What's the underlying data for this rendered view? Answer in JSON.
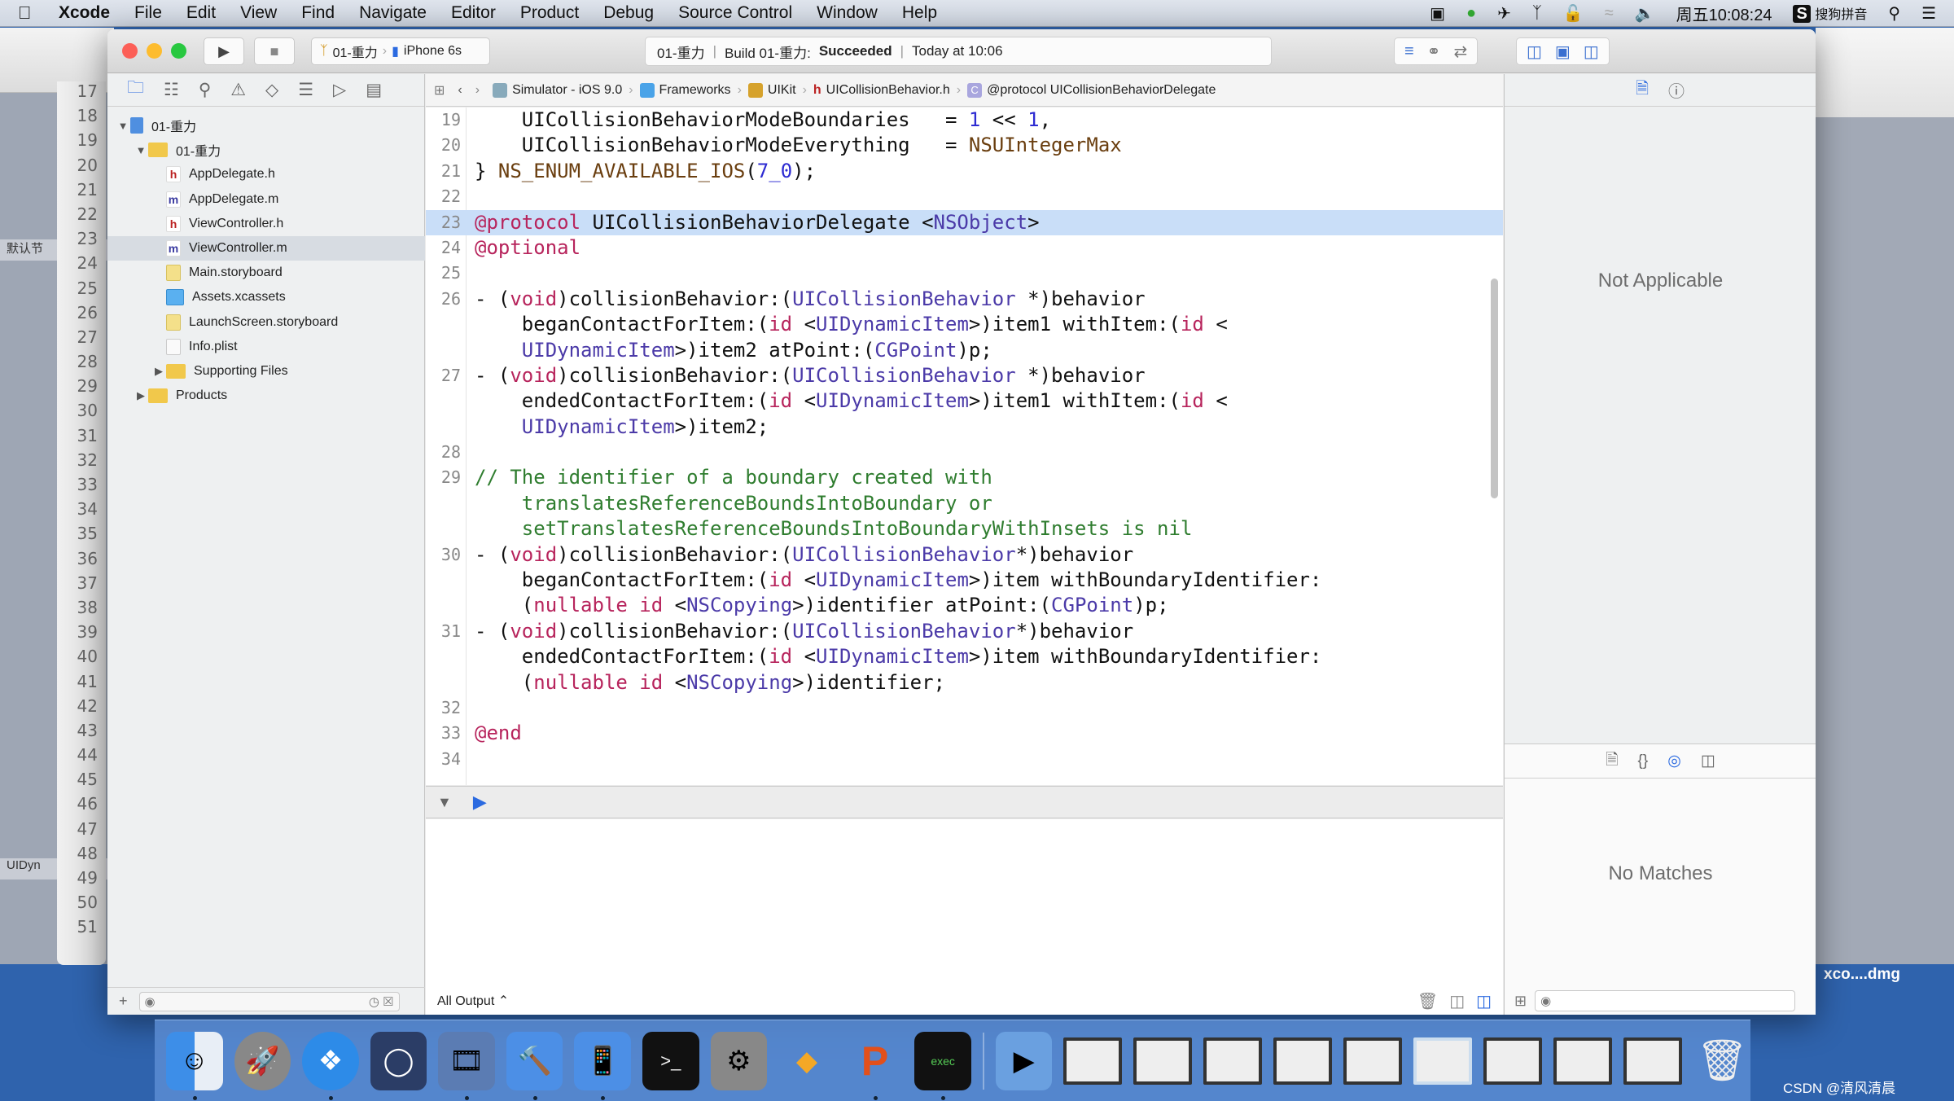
{
  "menubar": {
    "app": "Xcode",
    "items": [
      "File",
      "Edit",
      "View",
      "Find",
      "Navigate",
      "Editor",
      "Product",
      "Debug",
      "Source Control",
      "Window",
      "Help"
    ],
    "status": {
      "clock": "周五10:08:24",
      "input_method": "搜狗拼音",
      "icons": [
        "screen-record-icon",
        "app-status-icon",
        "airplane-icon",
        "bluetooth-icon",
        "lock-icon",
        "wifi-icon",
        "volume-icon",
        "input-method-icon",
        "spotlight-icon",
        "notification-center-icon"
      ]
    }
  },
  "toolbar": {
    "scheme": "01-重力",
    "device": "iPhone 6s",
    "activity": {
      "project": "01-重力",
      "build_prefix": "Build 01-重力:",
      "build_status": "Succeeded",
      "time": "Today at 10:06"
    }
  },
  "navigator": {
    "tabs": [
      "project-navigator",
      "symbol-navigator",
      "find-navigator",
      "issue-navigator",
      "test-navigator",
      "debug-navigator",
      "breakpoint-navigator",
      "report-navigator"
    ],
    "tree": [
      {
        "label": "01-重力",
        "type": "project",
        "level": 0,
        "expanded": true
      },
      {
        "label": "01-重力",
        "type": "folder",
        "level": 1,
        "expanded": true
      },
      {
        "label": "AppDelegate.h",
        "type": "h",
        "level": 2
      },
      {
        "label": "AppDelegate.m",
        "type": "m",
        "level": 2
      },
      {
        "label": "ViewController.h",
        "type": "h",
        "level": 2
      },
      {
        "label": "ViewController.m",
        "type": "m",
        "level": 2,
        "selected": true
      },
      {
        "label": "Main.storyboard",
        "type": "storyboard",
        "level": 2
      },
      {
        "label": "Assets.xcassets",
        "type": "xcassets",
        "level": 2
      },
      {
        "label": "LaunchScreen.storyboard",
        "type": "storyboard",
        "level": 2
      },
      {
        "label": "Info.plist",
        "type": "plist",
        "level": 2
      },
      {
        "label": "Supporting Files",
        "type": "folder",
        "level": 2,
        "expanded": false
      },
      {
        "label": "Products",
        "type": "folder",
        "level": 1,
        "expanded": false
      }
    ]
  },
  "jumpbar": {
    "crumbs": [
      "Simulator - iOS 9.0",
      "Frameworks",
      "UIKit",
      "UICollisionBehavior.h",
      "@protocol UICollisionBehaviorDelegate"
    ]
  },
  "editor": {
    "lines": [
      {
        "n": "19",
        "html": "    UICollisionBehaviorModeBoundaries   = <span class=\"num\">1</span> &lt;&lt; <span class=\"num\">1</span>,"
      },
      {
        "n": "20",
        "html": "    UICollisionBehaviorModeEverything   = <span class=\"mac\">NSUIntegerMax</span>"
      },
      {
        "n": "21",
        "html": "} <span class=\"mac\">NS_ENUM_AVAILABLE_IOS</span>(<span class=\"num\">7_0</span>);"
      },
      {
        "n": "22",
        "html": ""
      },
      {
        "n": "23",
        "html": "<span class=\"kw\">@protocol</span> UICollisionBehaviorDelegate &lt;<span class=\"ty\">NSObject</span>&gt;",
        "hl": true
      },
      {
        "n": "24",
        "html": "<span class=\"kw\">@optional</span>"
      },
      {
        "n": "25",
        "html": ""
      },
      {
        "n": "26",
        "html": "- (<span class=\"kw\">void</span>)collisionBehavior:(<span class=\"ty\">UICollisionBehavior</span> *)behavior"
      },
      {
        "n": "",
        "html": "    beganContactForItem:(<span class=\"kw\">id</span> &lt;<span class=\"ty\">UIDynamicItem</span>&gt;)item1 withItem:(<span class=\"kw\">id</span> &lt;"
      },
      {
        "n": "",
        "html": "    <span class=\"ty\">UIDynamicItem</span>&gt;)item2 atPoint:(<span class=\"ty\">CGPoint</span>)p;"
      },
      {
        "n": "27",
        "html": "- (<span class=\"kw\">void</span>)collisionBehavior:(<span class=\"ty\">UICollisionBehavior</span> *)behavior"
      },
      {
        "n": "",
        "html": "    endedContactForItem:(<span class=\"kw\">id</span> &lt;<span class=\"ty\">UIDynamicItem</span>&gt;)item1 withItem:(<span class=\"kw\">id</span> &lt;"
      },
      {
        "n": "",
        "html": "    <span class=\"ty\">UIDynamicItem</span>&gt;)item2;"
      },
      {
        "n": "28",
        "html": ""
      },
      {
        "n": "29",
        "html": "<span class=\"cm\">// The identifier of a boundary created with</span>"
      },
      {
        "n": "",
        "html": "<span class=\"cm\">    translatesReferenceBoundsIntoBoundary or</span>"
      },
      {
        "n": "",
        "html": "<span class=\"cm\">    setTranslatesReferenceBoundsIntoBoundaryWithInsets is nil</span>"
      },
      {
        "n": "30",
        "html": "- (<span class=\"kw\">void</span>)collisionBehavior:(<span class=\"ty\">UICollisionBehavior</span>*)behavior"
      },
      {
        "n": "",
        "html": "    beganContactForItem:(<span class=\"kw\">id</span> &lt;<span class=\"ty\">UIDynamicItem</span>&gt;)item withBoundaryIdentifier:"
      },
      {
        "n": "",
        "html": "    (<span class=\"kw\">nullable</span> <span class=\"kw\">id</span> &lt;<span class=\"ty\">NSCopying</span>&gt;)identifier atPoint:(<span class=\"ty\">CGPoint</span>)p;"
      },
      {
        "n": "31",
        "html": "- (<span class=\"kw\">void</span>)collisionBehavior:(<span class=\"ty\">UICollisionBehavior</span>*)behavior"
      },
      {
        "n": "",
        "html": "    endedContactForItem:(<span class=\"kw\">id</span> &lt;<span class=\"ty\">UIDynamicItem</span>&gt;)item withBoundaryIdentifier:"
      },
      {
        "n": "",
        "html": "    (<span class=\"kw\">nullable</span> <span class=\"kw\">id</span> &lt;<span class=\"ty\">NSCopying</span>&gt;)identifier;"
      },
      {
        "n": "32",
        "html": ""
      },
      {
        "n": "33",
        "html": "<span class=\"kw\">@end</span>"
      },
      {
        "n": "34",
        "html": ""
      }
    ]
  },
  "console": {
    "filter": "All Output ⌃"
  },
  "inspector": {
    "empty_text": "Not Applicable",
    "library_empty_text": "No Matches"
  },
  "background_app": {
    "line_numbers": [
      "17",
      "18",
      "19",
      "20",
      "21",
      "22",
      "23",
      "24",
      "25",
      "26",
      "27",
      "28",
      "29",
      "30",
      "31",
      "32",
      "33",
      "34",
      "35",
      "36",
      "37",
      "38",
      "39",
      "40",
      "41",
      "42",
      "43",
      "44",
      "45",
      "46",
      "47",
      "48",
      "49",
      "50",
      "51"
    ],
    "section_labels": [
      "默认节",
      "UIDyn"
    ],
    "desktop_file": "xco....dmg"
  },
  "dock": {
    "apps": [
      "Finder",
      "Launchpad",
      "Safari",
      "Mouse",
      "Photo Slideshow",
      "Xcode",
      "Simulator",
      "Terminal",
      "System Preferences",
      "Sketch",
      "PowerPoint",
      "Console"
    ]
  },
  "watermark": "CSDN @清风清晨",
  "colors": {
    "keyword": "#b7245c",
    "type": "#4b3aa8",
    "comment": "#2f7d2f",
    "number": "#2d2bd2",
    "highlight": "#c9def8",
    "accent": "#2b6ae0"
  }
}
